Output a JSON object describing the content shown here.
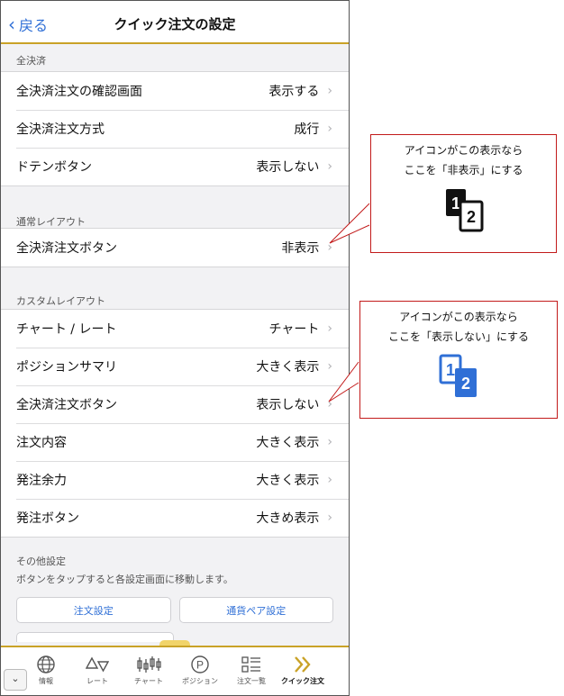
{
  "nav": {
    "back_label": "戻る",
    "title": "クイック注文の設定"
  },
  "sections": [
    {
      "header": "全決済",
      "rows": [
        {
          "label": "全決済注文の確認画面",
          "value": "表示する"
        },
        {
          "label": "全決済注文方式",
          "value": "成行"
        },
        {
          "label": "ドテンボタン",
          "value": "表示しない"
        }
      ]
    },
    {
      "header": "通常レイアウト",
      "rows": [
        {
          "label": "全決済注文ボタン",
          "value": "非表示"
        }
      ]
    },
    {
      "header": "カスタムレイアウト",
      "rows": [
        {
          "label": "チャート / レート",
          "value": "チャート"
        },
        {
          "label": "ポジションサマリ",
          "value": "大きく表示"
        },
        {
          "label": "全決済注文ボタン",
          "value": "表示しない"
        },
        {
          "label": "注文内容",
          "value": "大きく表示"
        },
        {
          "label": "発注余力",
          "value": "大きく表示"
        },
        {
          "label": "発注ボタン",
          "value": "大きめ表示"
        }
      ]
    }
  ],
  "other": {
    "header": "その他設定",
    "description": "ボタンをタップすると各設定画面に移動します。",
    "buttons": [
      "注文設定",
      "通貨ペア設定"
    ]
  },
  "tabbar": {
    "collapse_icon": "chevron-down",
    "items": [
      {
        "label": "情報",
        "icon": "globe-icon"
      },
      {
        "label": "レート",
        "icon": "triangles-icon"
      },
      {
        "label": "チャート",
        "icon": "candlestick-icon"
      },
      {
        "label": "ポジション",
        "icon": "p-circle-icon"
      },
      {
        "label": "注文一覧",
        "icon": "list-icon"
      },
      {
        "label": "クイック注文",
        "icon": "double-chevron-icon"
      }
    ],
    "active_index": 5,
    "accent": "#c9a227"
  },
  "callouts": [
    {
      "line1": "アイコンがこの表示なら",
      "line2": "ここを「非表示」にする",
      "icon": "half-icon-black"
    },
    {
      "line1": "アイコンがこの表示なら",
      "line2": "ここを「表示しない」にする",
      "icon": "half-icon-blue"
    }
  ],
  "colors": {
    "link": "#2f6fd6",
    "callout_border": "#c21a1a",
    "icon_blue": "#2f6fd6"
  }
}
